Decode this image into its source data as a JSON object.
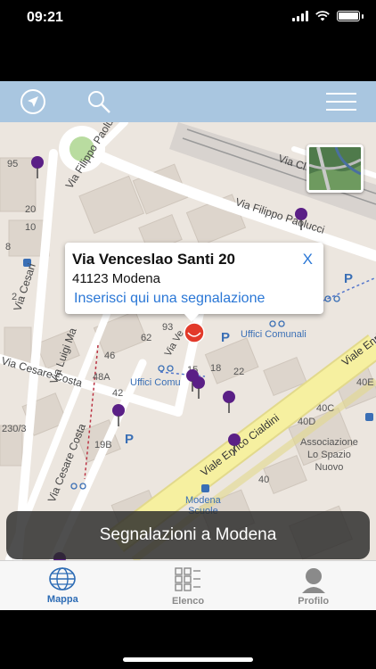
{
  "status_bar": {
    "time": "09:21"
  },
  "toolbar": {
    "locate_icon": "location-arrow-icon",
    "search_icon": "search-icon",
    "menu_icon": "hamburger-menu-icon"
  },
  "map": {
    "labels": {
      "piazzale": "Via Filippo Paolucci",
      "via_paolucci": "Via Filippo Paolucci",
      "via_cl": "Via Cl",
      "via_cesari": "Via Cesari",
      "via_luigi_ma": "Via Luigi Ma",
      "via_cesare_costa": "Via Cesare Costa",
      "via_cesare_costa2": "Via Cesare Costa",
      "viale_enrico_cialdini": "Viale Enrico Cialdini",
      "viale_enri": "Viale Enri",
      "uffici_comunali": "Uffici Comunali",
      "uffici_comu": "Uffici Comu",
      "associazione": "Associazione\nLo Spazio\nNuovo",
      "modena_scuole": "Modena\nScuole",
      "via_ve": "Via Ve",
      "n95": "95",
      "n20": "20",
      "n10": "10",
      "n8": "8",
      "n2": "2",
      "n62": "62",
      "n93": "93",
      "n18": "18",
      "n22": "22",
      "n15": "15",
      "n48a": "48A",
      "n46": "46",
      "n42": "42",
      "n19b": "19B",
      "n40": "40",
      "n40e": "40E",
      "n40d": "40D",
      "n40c": "40C",
      "n230": "230/3"
    }
  },
  "callout": {
    "title": "Via Venceslao Santi 20",
    "subtitle": "41123 Modena",
    "link": "Inserisci qui una segnalazione",
    "close": "X"
  },
  "toast": {
    "text": "Segnalazioni a Modena"
  },
  "tabbar": {
    "tabs": [
      {
        "label": "Mappa",
        "icon": "globe-icon",
        "active": true
      },
      {
        "label": "Elenco",
        "icon": "list-grid-icon",
        "active": false
      },
      {
        "label": "Profilo",
        "icon": "user-icon",
        "active": false
      }
    ]
  },
  "colors": {
    "toolbar": "#a9c6e0",
    "accent": "#2d6cb5",
    "pin": "#5a1f86",
    "road_main": "#f6f0a0"
  }
}
